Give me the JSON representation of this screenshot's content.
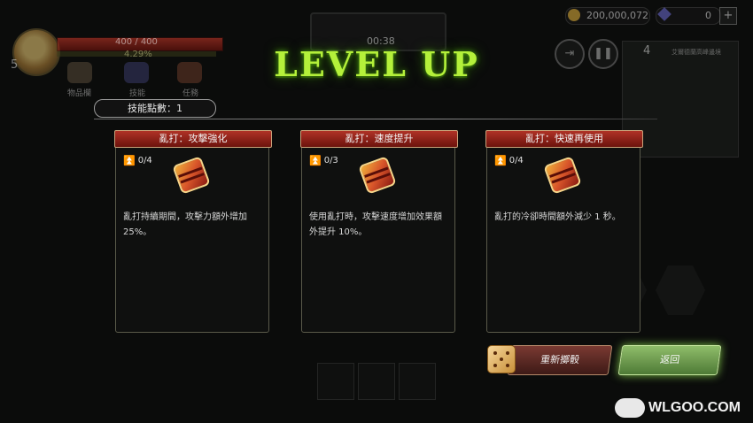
{
  "hud": {
    "player_level": "5",
    "hp": "400 / 400",
    "exp_percent": "4.29%",
    "menu": [
      {
        "label": "物品欄"
      },
      {
        "label": "技能"
      },
      {
        "label": "任務"
      }
    ],
    "timer": "00:38",
    "gold": "200,000,072",
    "gems": "0",
    "plus_label": "+",
    "minimap_level": "4",
    "minimap_title": "艾爾德蘭高峰邊境"
  },
  "overlay": {
    "title": "LEVEL UP",
    "skill_points": "技能點數：1",
    "cards": [
      {
        "name": "亂打：攻擊強化",
        "level": "0/4",
        "desc": "亂打持續期間，攻擊力額外增加 25%。"
      },
      {
        "name": "亂打：速度提升",
        "level": "0/3",
        "desc": "使用亂打時，攻擊速度增加效果額外提升 10%。"
      },
      {
        "name": "亂打：快速再使用",
        "level": "0/4",
        "desc": "亂打的冷卻時間額外減少 1 秒。"
      }
    ],
    "reroll_label": "重新擲骰",
    "back_label": "返回"
  },
  "watermark": "WLGOO.COM",
  "colors": {
    "title_glow": "#b4f03a",
    "card_header": "#b03226",
    "back_button": "#8fbd6a",
    "upgrade_arrow": "#7ed321"
  },
  "icons": [
    "upgrade-arrow-icon",
    "brawl-skill-icon",
    "dice-icon",
    "exit-icon",
    "pause-icon",
    "gamepad-icon"
  ]
}
